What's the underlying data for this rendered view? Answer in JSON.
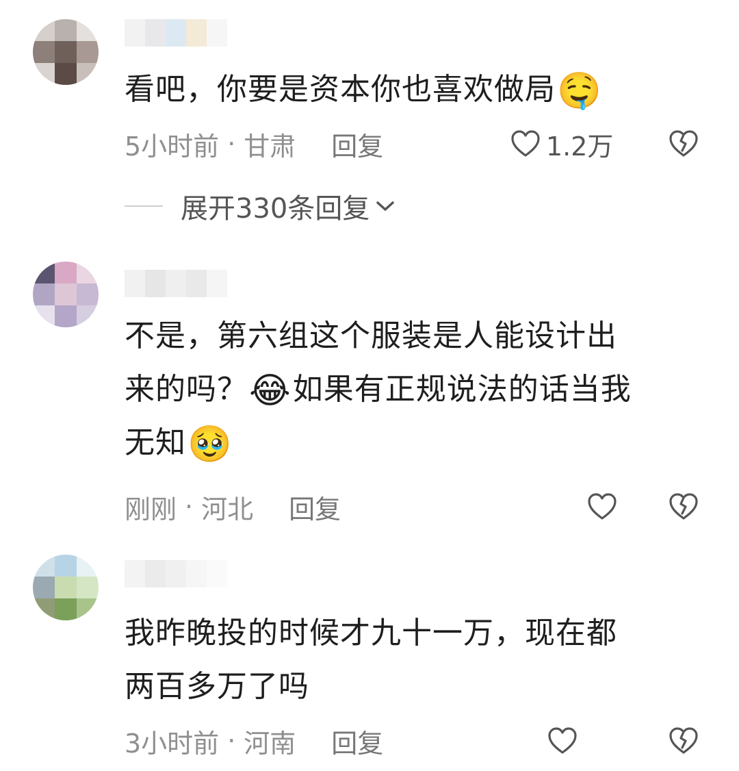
{
  "comments": [
    {
      "text": "看吧，你要是资本你也喜欢做局",
      "emoji_after": "🤤",
      "time": "5小时前",
      "location": "甘肃",
      "reply_label": "回复",
      "like_count": "1.2万",
      "expand_label": "展开330条回复"
    },
    {
      "text_line1": "不是，第六组这个服装是人能设计出",
      "text_line2a": "来的吗？",
      "emoji_mid": "😂",
      "text_line2b": "如果有正规说法的话当我",
      "text_line3": "无知",
      "emoji_end": "🥹",
      "time": "刚刚",
      "location": "河北",
      "reply_label": "回复"
    },
    {
      "text_line1": "我昨晚投的时候才九十一万，现在都",
      "text_line2": "两百多万了吗",
      "time": "3小时前",
      "location": "河南",
      "reply_label": "回复"
    }
  ],
  "separator": "·",
  "colors": {
    "text": "#1e1e1e",
    "meta": "#8f8f8f",
    "icon": "#555555"
  },
  "icons": [
    "heart-icon",
    "broken-heart-icon",
    "chevron-down-icon"
  ]
}
